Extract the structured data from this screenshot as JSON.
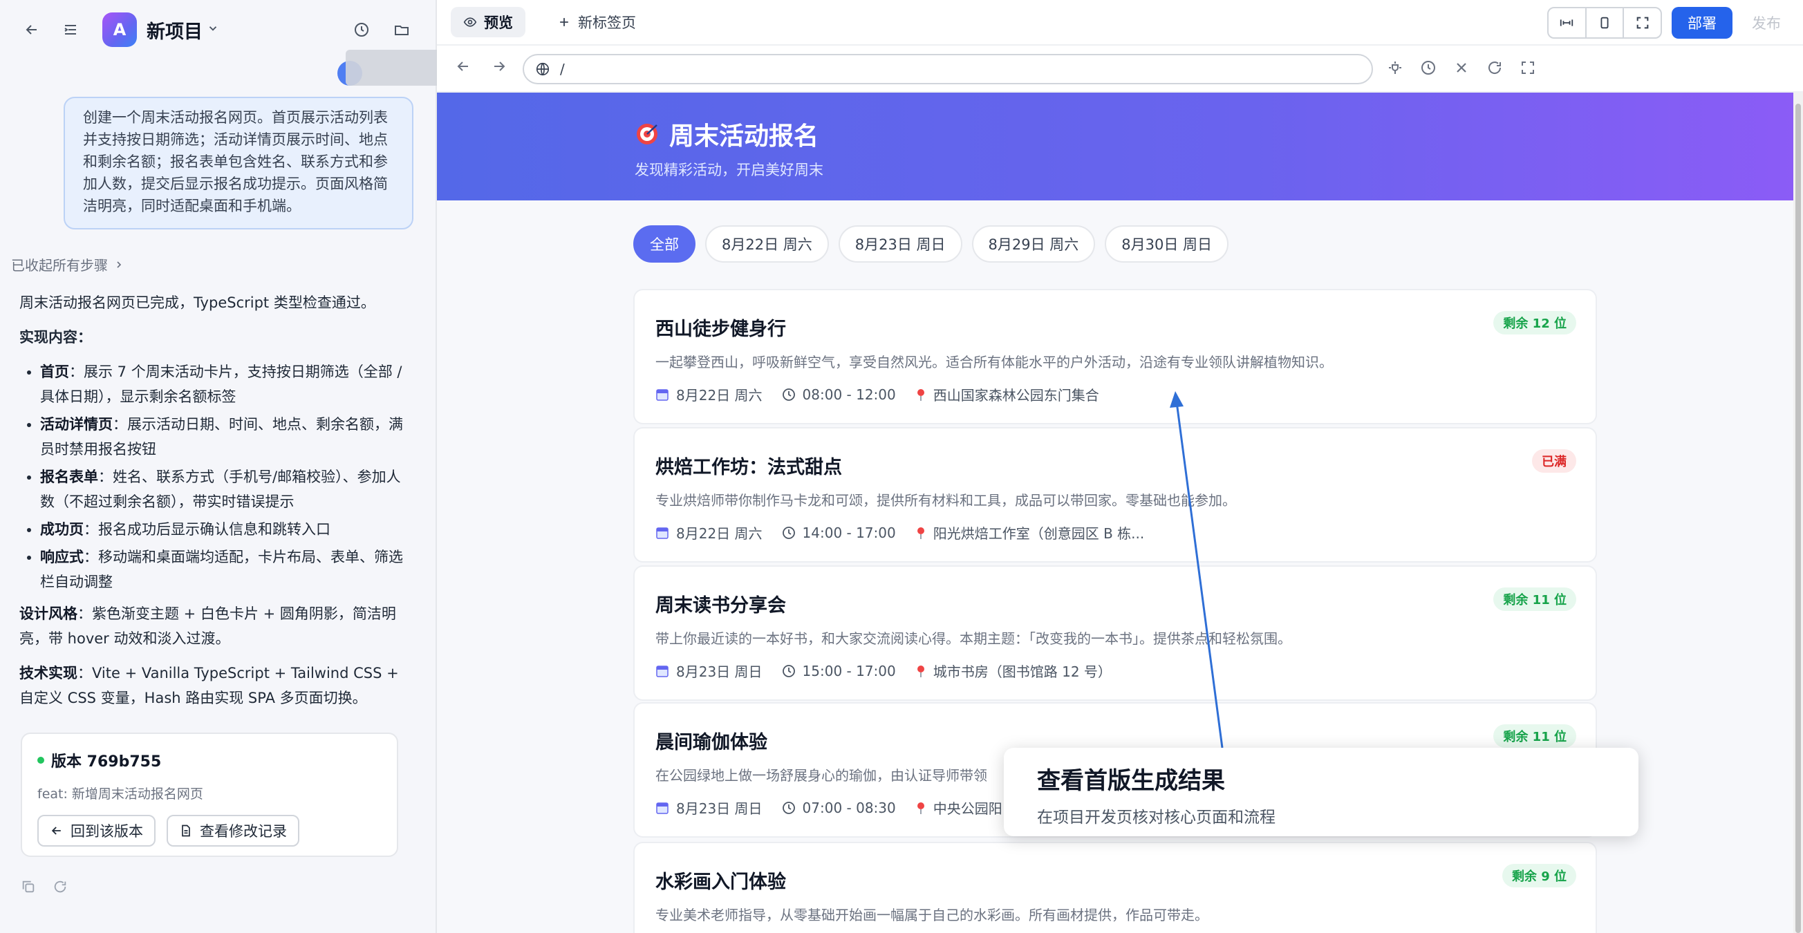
{
  "left_panel": {
    "project_logo_letter": "A",
    "project_name": "新项目",
    "user_prompt": "创建一个周末活动报名网页。首页展示活动列表并支持按日期筛选；活动详情页展示时间、地点和剩余名额；报名表单包含姓名、联系方式和参加人数，提交后显示报名成功提示。页面风格简洁明亮，同时适配桌面和手机端。",
    "collapsed_steps": "已收起所有步骤",
    "reply": {
      "intro": "周末活动报名网页已完成，TypeScript 类型检查通过。",
      "section_title": "实现内容：",
      "items": [
        {
          "label": "首页",
          "text": "：展示 7 个周末活动卡片，支持按日期筛选（全部 / 具体日期），显示剩余名额标签"
        },
        {
          "label": "活动详情页",
          "text": "：展示活动日期、时间、地点、剩余名额，满员时禁用报名按钮"
        },
        {
          "label": "报名表单",
          "text": "：姓名、联系方式（手机号/邮箱校验）、参加人数（不超过剩余名额），带实时错误提示"
        },
        {
          "label": "成功页",
          "text": "：报名成功后显示确认信息和跳转入口"
        },
        {
          "label": "响应式",
          "text": "：移动端和桌面端均适配，卡片布局、表单、筛选栏自动调整"
        }
      ],
      "design_label": "设计风格",
      "design_text": "：紫色渐变主题 + 白色卡片 + 圆角阴影，简洁明亮，带 hover 动效和淡入过渡。",
      "tech_label": "技术实现",
      "tech_text": "：Vite + Vanilla TypeScript + Tailwind CSS + 自定义 CSS 变量，Hash 路由实现 SPA 多页面切换。"
    },
    "version": {
      "title": "版本 769b755",
      "message": "feat: 新增周末活动报名网页",
      "rollback_label": "回到该版本",
      "changes_label": "查看修改记录"
    }
  },
  "topbar": {
    "preview_tab": "预览",
    "new_tab": "新标签页",
    "deploy": "部署",
    "publish": "发布"
  },
  "address": {
    "url": "/"
  },
  "page": {
    "hero_title": "周末活动报名",
    "hero_subtitle": "发现精彩活动，开启美好周末",
    "filters": [
      "全部",
      "8月22日 周六",
      "8月23日 周日",
      "8月29日 周六",
      "8月30日 周日"
    ],
    "events": [
      {
        "title": "西山徒步健身行",
        "desc": "一起攀登西山，呼吸新鲜空气，享受自然风光。适合所有体能水平的户外活动，沿途有专业领队讲解植物知识。",
        "date": "8月22日 周六",
        "time": "08:00 - 12:00",
        "place": "西山国家森林公园东门集合",
        "badge": "剩余 12 位",
        "full": false
      },
      {
        "title": "烘焙工作坊：法式甜点",
        "desc": "专业烘焙师带你制作马卡龙和可颂，提供所有材料和工具，成品可以带回家。零基础也能参加。",
        "date": "8月22日 周六",
        "time": "14:00 - 17:00",
        "place": "阳光烘焙工作室（创意园区 B 栋...",
        "badge": "已满",
        "full": true
      },
      {
        "title": "周末读书分享会",
        "desc": "带上你最近读的一本好书，和大家交流阅读心得。本期主题：「改变我的一本书」。提供茶点和轻松氛围。",
        "date": "8月23日 周日",
        "time": "15:00 - 17:00",
        "place": "城市书房（图书馆路 12 号）",
        "badge": "剩余 11 位",
        "full": false
      },
      {
        "title": "晨间瑜伽体验",
        "desc": "在公园绿地上做一场舒展身心的瑜伽，由认证导师带领",
        "date": "8月23日 周日",
        "time": "07:00 - 08:30",
        "place": "中央公园阳",
        "badge": "剩余 11 位",
        "full": false
      },
      {
        "title": "水彩画入门体验",
        "desc": "专业美术老师指导，从零基础开始画一幅属于自己的水彩画。所有画材提供，作品可带走。",
        "date": "",
        "time": "",
        "place": "",
        "badge": "剩余 9 位",
        "full": false
      }
    ]
  },
  "callout": {
    "title": "查看首版生成结果",
    "subtitle": "在项目开发页核对核心页面和流程"
  },
  "colors": {
    "accent": "#5b6cf0",
    "deploy": "#2563eb",
    "badge_ok": "#16a34a",
    "badge_full": "#dc2626",
    "arrow": "#2f6fd6"
  }
}
